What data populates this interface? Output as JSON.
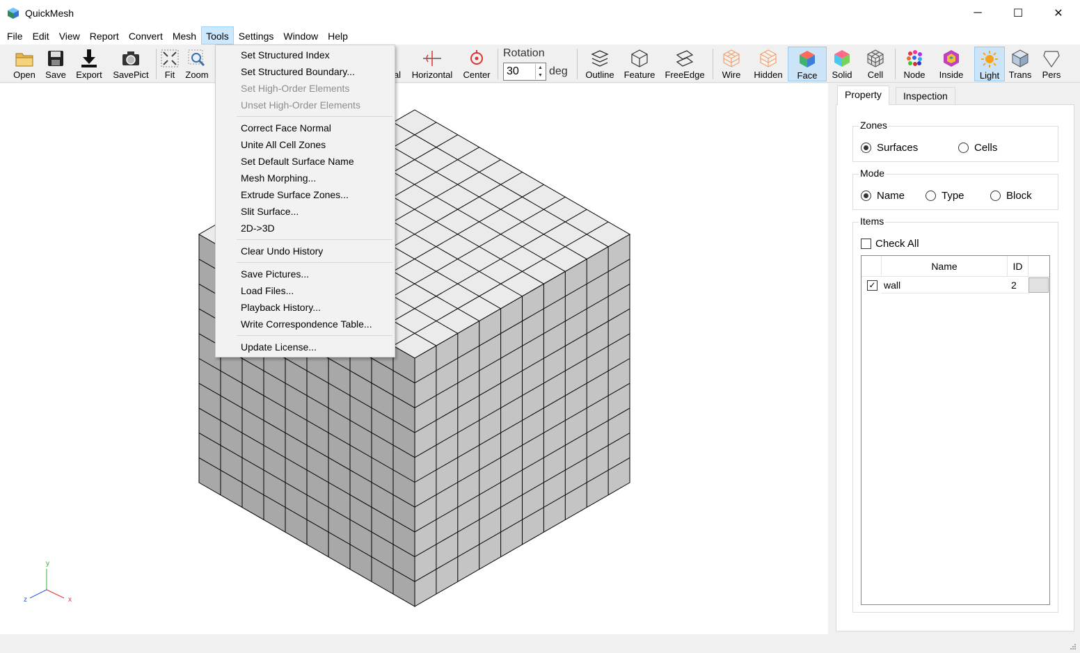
{
  "window": {
    "title": "QuickMesh",
    "controls": {
      "minimize": "─",
      "maximize": "☐",
      "close": "✕"
    }
  },
  "menubar": {
    "items": [
      "File",
      "Edit",
      "View",
      "Report",
      "Convert",
      "Mesh",
      "Tools",
      "Settings",
      "Window",
      "Help"
    ],
    "active": "Tools"
  },
  "toolbar": {
    "buttons": [
      {
        "label": "Open",
        "icon": "folder-icon"
      },
      {
        "label": "Save",
        "icon": "save-icon"
      },
      {
        "label": "Export",
        "icon": "export-icon"
      },
      {
        "label": "SavePict",
        "icon": "camera-icon"
      },
      {
        "label": "Fit",
        "icon": "fit-icon"
      },
      {
        "label": "Zoom",
        "icon": "zoom-icon"
      },
      {
        "label": "al",
        "icon": ""
      },
      {
        "label": "Horizontal",
        "icon": "horizontal-icon"
      },
      {
        "label": "Center",
        "icon": "center-icon"
      },
      {
        "label": "Outline",
        "icon": "outline-icon"
      },
      {
        "label": "Feature",
        "icon": "feature-icon"
      },
      {
        "label": "FreeEdge",
        "icon": "freeedge-icon"
      },
      {
        "label": "Wire",
        "icon": "wire-icon"
      },
      {
        "label": "Hidden",
        "icon": "hidden-icon"
      },
      {
        "label": "Face",
        "icon": "face-icon",
        "pressed": true
      },
      {
        "label": "Solid",
        "icon": "solid-icon"
      },
      {
        "label": "Cell",
        "icon": "cell-icon"
      },
      {
        "label": "Node",
        "icon": "node-icon"
      },
      {
        "label": "Inside",
        "icon": "inside-icon"
      },
      {
        "label": "Light",
        "icon": "light-icon",
        "pressed": true
      },
      {
        "label": "Trans",
        "icon": "trans-icon"
      },
      {
        "label": "Pers",
        "icon": "pers-icon"
      }
    ],
    "rotation": {
      "label": "Rotation",
      "value": "30",
      "unit": "deg"
    }
  },
  "tools_menu": {
    "items": [
      {
        "label": "Set Structured Index",
        "enabled": true
      },
      {
        "label": "Set Structured Boundary...",
        "enabled": true
      },
      {
        "label": "Set High-Order Elements",
        "enabled": false
      },
      {
        "label": "Unset High-Order Elements",
        "enabled": false
      },
      {
        "label": "Correct Face Normal",
        "enabled": true
      },
      {
        "label": "Unite All Cell Zones",
        "enabled": true
      },
      {
        "label": "Set Default Surface Name",
        "enabled": true
      },
      {
        "label": "Mesh Morphing...",
        "enabled": true
      },
      {
        "label": "Extrude Surface Zones...",
        "enabled": true
      },
      {
        "label": "Slit Surface...",
        "enabled": true
      },
      {
        "label": "2D->3D",
        "enabled": true
      },
      {
        "label": "Clear Undo History",
        "enabled": true
      },
      {
        "label": "Save Pictures...",
        "enabled": true
      },
      {
        "label": "Load Files...",
        "enabled": true
      },
      {
        "label": "Playback History...",
        "enabled": true
      },
      {
        "label": "Write Correspondence Table...",
        "enabled": true
      },
      {
        "label": "Update License...",
        "enabled": true
      }
    ]
  },
  "panel": {
    "tabs": [
      "Property",
      "Inspection"
    ],
    "active_tab": "Property",
    "zones": {
      "title": "Zones",
      "options": [
        "Surfaces",
        "Cells"
      ],
      "selected": "Surfaces"
    },
    "mode": {
      "title": "Mode",
      "options": [
        "Name",
        "Type",
        "Block"
      ],
      "selected": "Name"
    },
    "items": {
      "title": "Items",
      "check_all": "Check All",
      "columns": [
        "Name",
        "ID"
      ],
      "rows": [
        {
          "checked": true,
          "check_mark": "✓",
          "name": "wall",
          "id": "2"
        }
      ]
    }
  },
  "axes": {
    "x": "x",
    "y": "y",
    "z": "z"
  },
  "colors": {
    "menu_highlight": "#cce8ff",
    "pressed": "#cce4f7",
    "mesh_top": "#ebebeb",
    "mesh_left": "#a8a8a8",
    "mesh_right": "#c4c4c4"
  }
}
